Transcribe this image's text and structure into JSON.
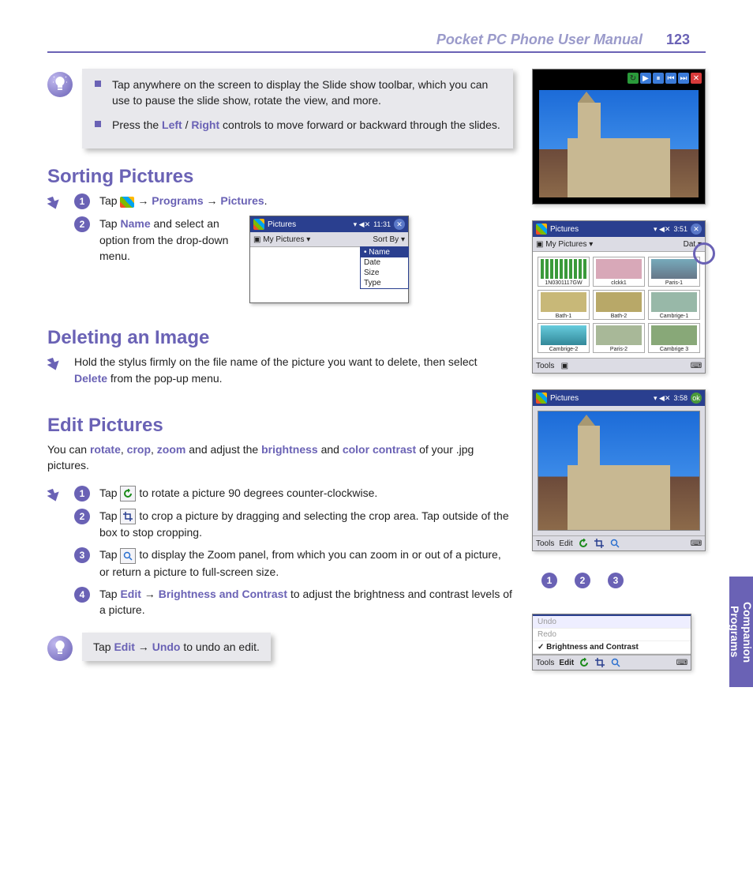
{
  "header": {
    "title": "Pocket PC Phone User Manual",
    "page_number": "123"
  },
  "side_tab": "Companion Programs",
  "tip1": {
    "bullets": [
      {
        "pre": "Tap anywhere on the screen to display the Slide show  toolbar, which you can use to pause the slide show, rotate the view, and more."
      },
      {
        "pre": "Press the ",
        "kw1": "Left",
        "sep": " / ",
        "kw2": "Right",
        "post": " controls to move forward or backward through the slides."
      }
    ]
  },
  "sorting": {
    "heading": "Sorting Pictures",
    "steps": [
      {
        "num": "1",
        "a": "Tap ",
        "kw1": "Programs",
        "arrow": "→",
        "kw2": "Pictures",
        "end": "."
      },
      {
        "num": "2",
        "a": "Tap ",
        "kw1": "Name",
        "b": " and select an option  from the drop-down menu."
      }
    ]
  },
  "deleting": {
    "heading": "Deleting an Image",
    "body_a": "Hold the stylus firmly on the file name of the picture you want to delete, then select ",
    "kw": "Delete",
    "body_b": " from the pop-up menu."
  },
  "edit": {
    "heading": "Edit Pictures",
    "intro_a": "You can ",
    "kw1": "rotate",
    "c1": ", ",
    "kw2": "crop",
    "c2": ", ",
    "kw3": "zoom",
    "intro_b": " and adjust the ",
    "kw4": "brightness",
    "intro_c": " and ",
    "kw5": "color contrast",
    "intro_d": " of your .jpg pictures.",
    "steps": [
      {
        "num": "1",
        "a": "Tap ",
        "b": " to rotate a picture 90 degrees counter-clockwise."
      },
      {
        "num": "2",
        "a": "Tap ",
        "b": " to crop a picture by dragging and selecting the crop area. Tap outside of the box to stop cropping."
      },
      {
        "num": "3",
        "a": "Tap ",
        "b": " to display the Zoom panel, from which you can zoom in or out of a picture, or return a picture to full-screen size."
      },
      {
        "num": "4",
        "a": "Tap ",
        "kw1": "Edit",
        "arrow": " → ",
        "kw2": "Brightness and Contrast",
        "b": " to adjust the brightness and contrast levels of a picture."
      }
    ]
  },
  "tip2": {
    "a": "Tap ",
    "kw1": "Edit",
    "arrow": " → ",
    "kw2": "Undo",
    "b": " to undo an edit."
  },
  "sortby_shot": {
    "app": "Pictures",
    "time": "11:31",
    "folder": "My Pictures",
    "sort_label": "Sort By",
    "options": [
      "Name",
      "Date",
      "Size",
      "Type"
    ],
    "selected": "Name"
  },
  "grid_shot": {
    "app": "Pictures",
    "time": "3:51",
    "folder": "My Pictures",
    "date_btn": "Dat",
    "thumbs": [
      "1N0301117GW",
      "clckk1",
      "Paris-1",
      "Bath-1",
      "Bath-2",
      "Cambrige-1",
      "Cambrige-2",
      "Paris-2",
      "Cambrige 3"
    ],
    "tools": "Tools"
  },
  "editor_shot": {
    "app": "Pictures",
    "time": "3:58",
    "tools": "Tools",
    "edit": "Edit",
    "callouts": [
      "1",
      "2",
      "3"
    ]
  },
  "edit_menu": {
    "undo": "Undo",
    "redo": "Redo",
    "bc": "Brightness and Contrast",
    "tools": "Tools",
    "edit": "Edit"
  }
}
